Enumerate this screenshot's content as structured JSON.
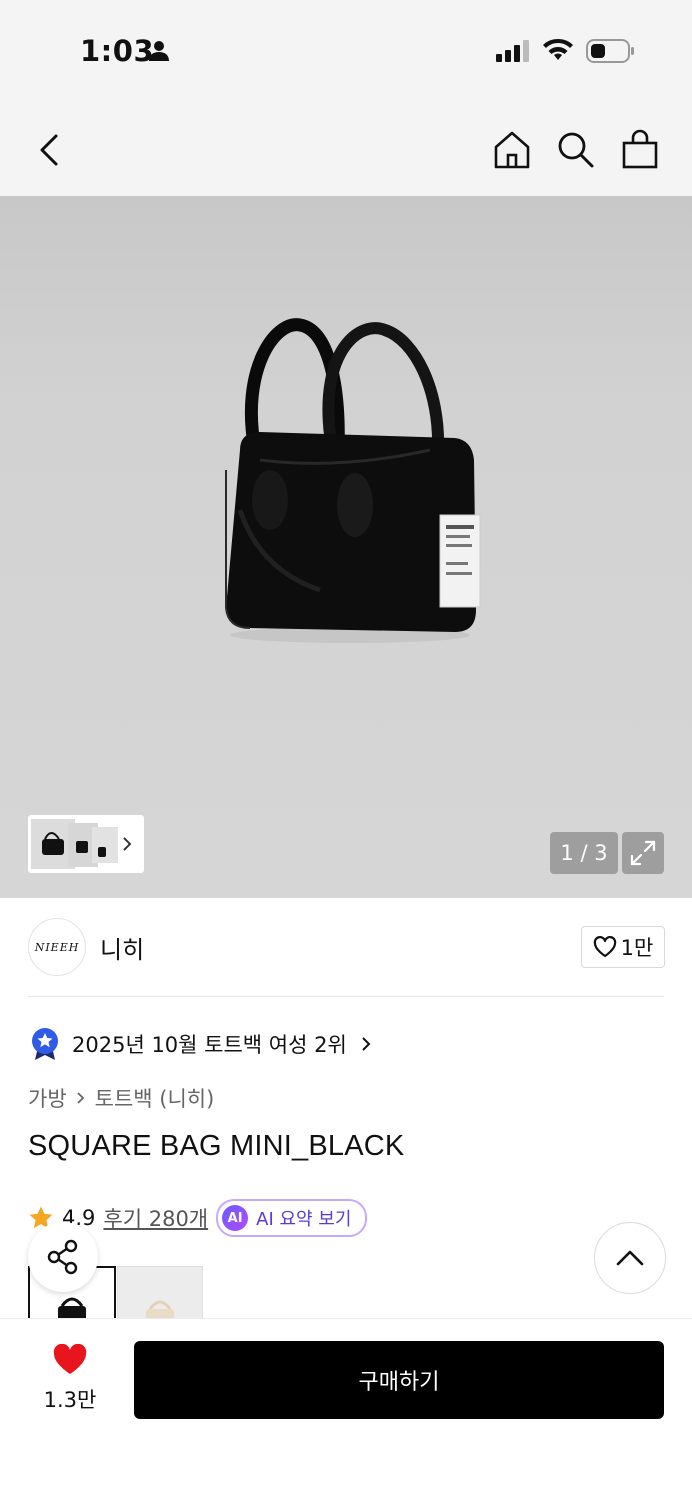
{
  "status_bar": {
    "time": "1:03"
  },
  "nav": {
    "back_icon": "chevron-left-icon",
    "home_icon": "home-icon",
    "search_icon": "search-icon",
    "cart_icon": "shopping-bag-icon"
  },
  "gallery": {
    "page_current": "1",
    "page_total": "3",
    "page_text": "1 / 3"
  },
  "brand": {
    "logo_text": "NIEEH",
    "name": "니히",
    "likes": "1만"
  },
  "ranking": {
    "text": "2025년 10월 토트백 여성 2위"
  },
  "breadcrumb": {
    "category": "가방",
    "subcategory": "토트백 (니히)"
  },
  "product": {
    "title": "SQUARE BAG MINI_BLACK"
  },
  "rating": {
    "score": "4.9",
    "reviews": "후기 280개",
    "ai_badge": "AI",
    "ai_label": "AI 요약 보기"
  },
  "bottom_bar": {
    "like_count": "1.3만",
    "buy_label": "구매하기"
  },
  "colors": {
    "accent": "#000000",
    "heart": "#e8141e",
    "star": "#f5a623",
    "ai_purple": "#5b3bd6"
  }
}
